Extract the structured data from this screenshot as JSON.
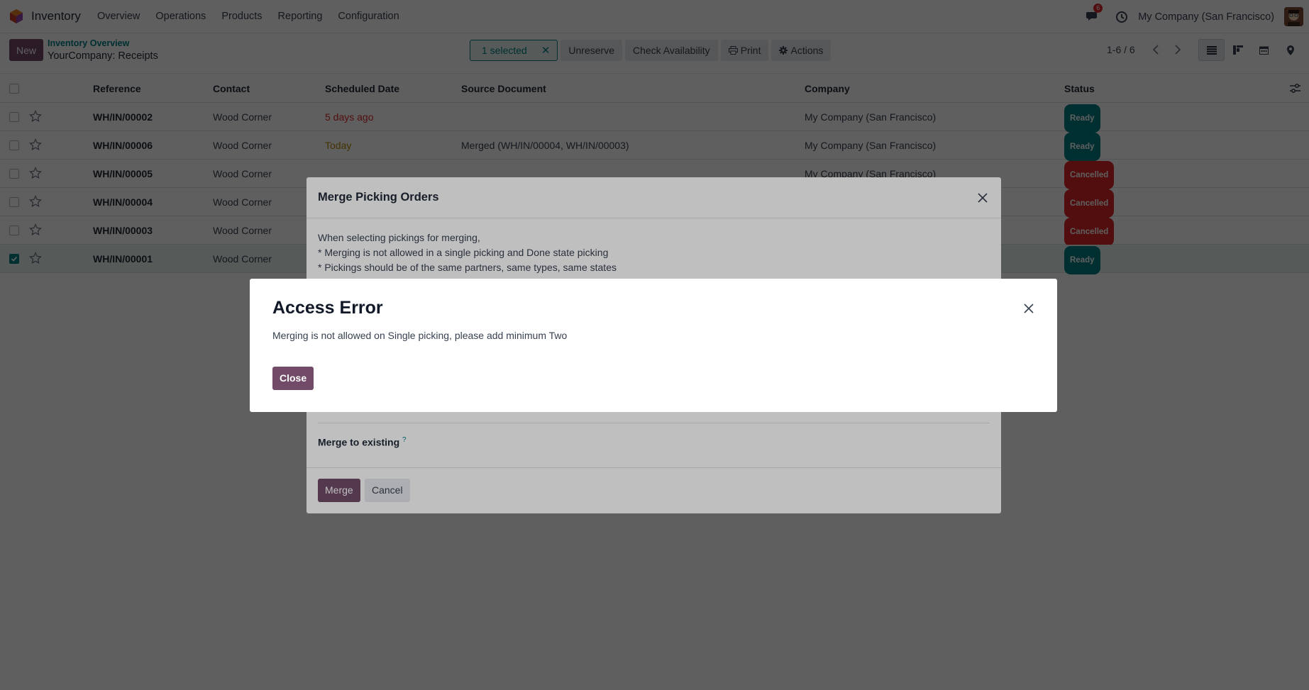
{
  "navbar": {
    "app_name": "Inventory",
    "menu": [
      "Overview",
      "Operations",
      "Products",
      "Reporting",
      "Configuration"
    ],
    "chat_badge": "6",
    "company": "My Company (San Francisco)"
  },
  "control": {
    "new_label": "New",
    "breadcrumb_parent": "Inventory Overview",
    "breadcrumb_current": "YourCompany: Receipts",
    "selected_label": "1 selected",
    "unreserve_label": "Unreserve",
    "check_label": "Check Availability",
    "print_label": "Print",
    "actions_label": "Actions",
    "pager": "1-6 / 6"
  },
  "list": {
    "headers": {
      "reference": "Reference",
      "contact": "Contact",
      "date": "Scheduled Date",
      "source": "Source Document",
      "company": "Company",
      "status": "Status"
    },
    "rows": [
      {
        "ref": "WH/IN/00002",
        "contact": "Wood Corner",
        "date": "5 days ago",
        "source": "",
        "company": "My Company (San Francisco)",
        "status": "Ready"
      },
      {
        "ref": "WH/IN/00006",
        "contact": "Wood Corner",
        "date": "Today",
        "source": "Merged (WH/IN/00004, WH/IN/00003)",
        "company": "My Company (San Francisco)",
        "status": "Ready"
      },
      {
        "ref": "WH/IN/00005",
        "contact": "Wood Corner",
        "date": "",
        "source": "",
        "company": "My Company (San Francisco)",
        "status": "Cancelled"
      },
      {
        "ref": "WH/IN/00004",
        "contact": "Wood Corner",
        "date": "",
        "source": "",
        "company": "",
        "status": "Cancelled"
      },
      {
        "ref": "WH/IN/00003",
        "contact": "Wood Corner",
        "date": "",
        "source": "",
        "company": "",
        "status": "Cancelled"
      },
      {
        "ref": "WH/IN/00001",
        "contact": "Wood Corner",
        "date": "",
        "source": "",
        "company": "",
        "status": "Ready"
      }
    ]
  },
  "merge_dialog": {
    "title": "Merge Picking Orders",
    "line1": "When selecting pickings for merging,",
    "line2": "* Merging is not allowed in a single picking and Done state picking",
    "line3": "* Pickings should be of the same partners, same types, same states",
    "field_label": "Merge to existing",
    "field_help": "?",
    "merge_label": "Merge",
    "cancel_label": "Cancel"
  },
  "error_dialog": {
    "title": "Access Error",
    "message": "Merging is not allowed on Single picking, please add minimum Two",
    "close_label": "Close"
  },
  "colors": {
    "brand": "#714b67",
    "accent": "#017e84",
    "danger": "#dc2626"
  }
}
